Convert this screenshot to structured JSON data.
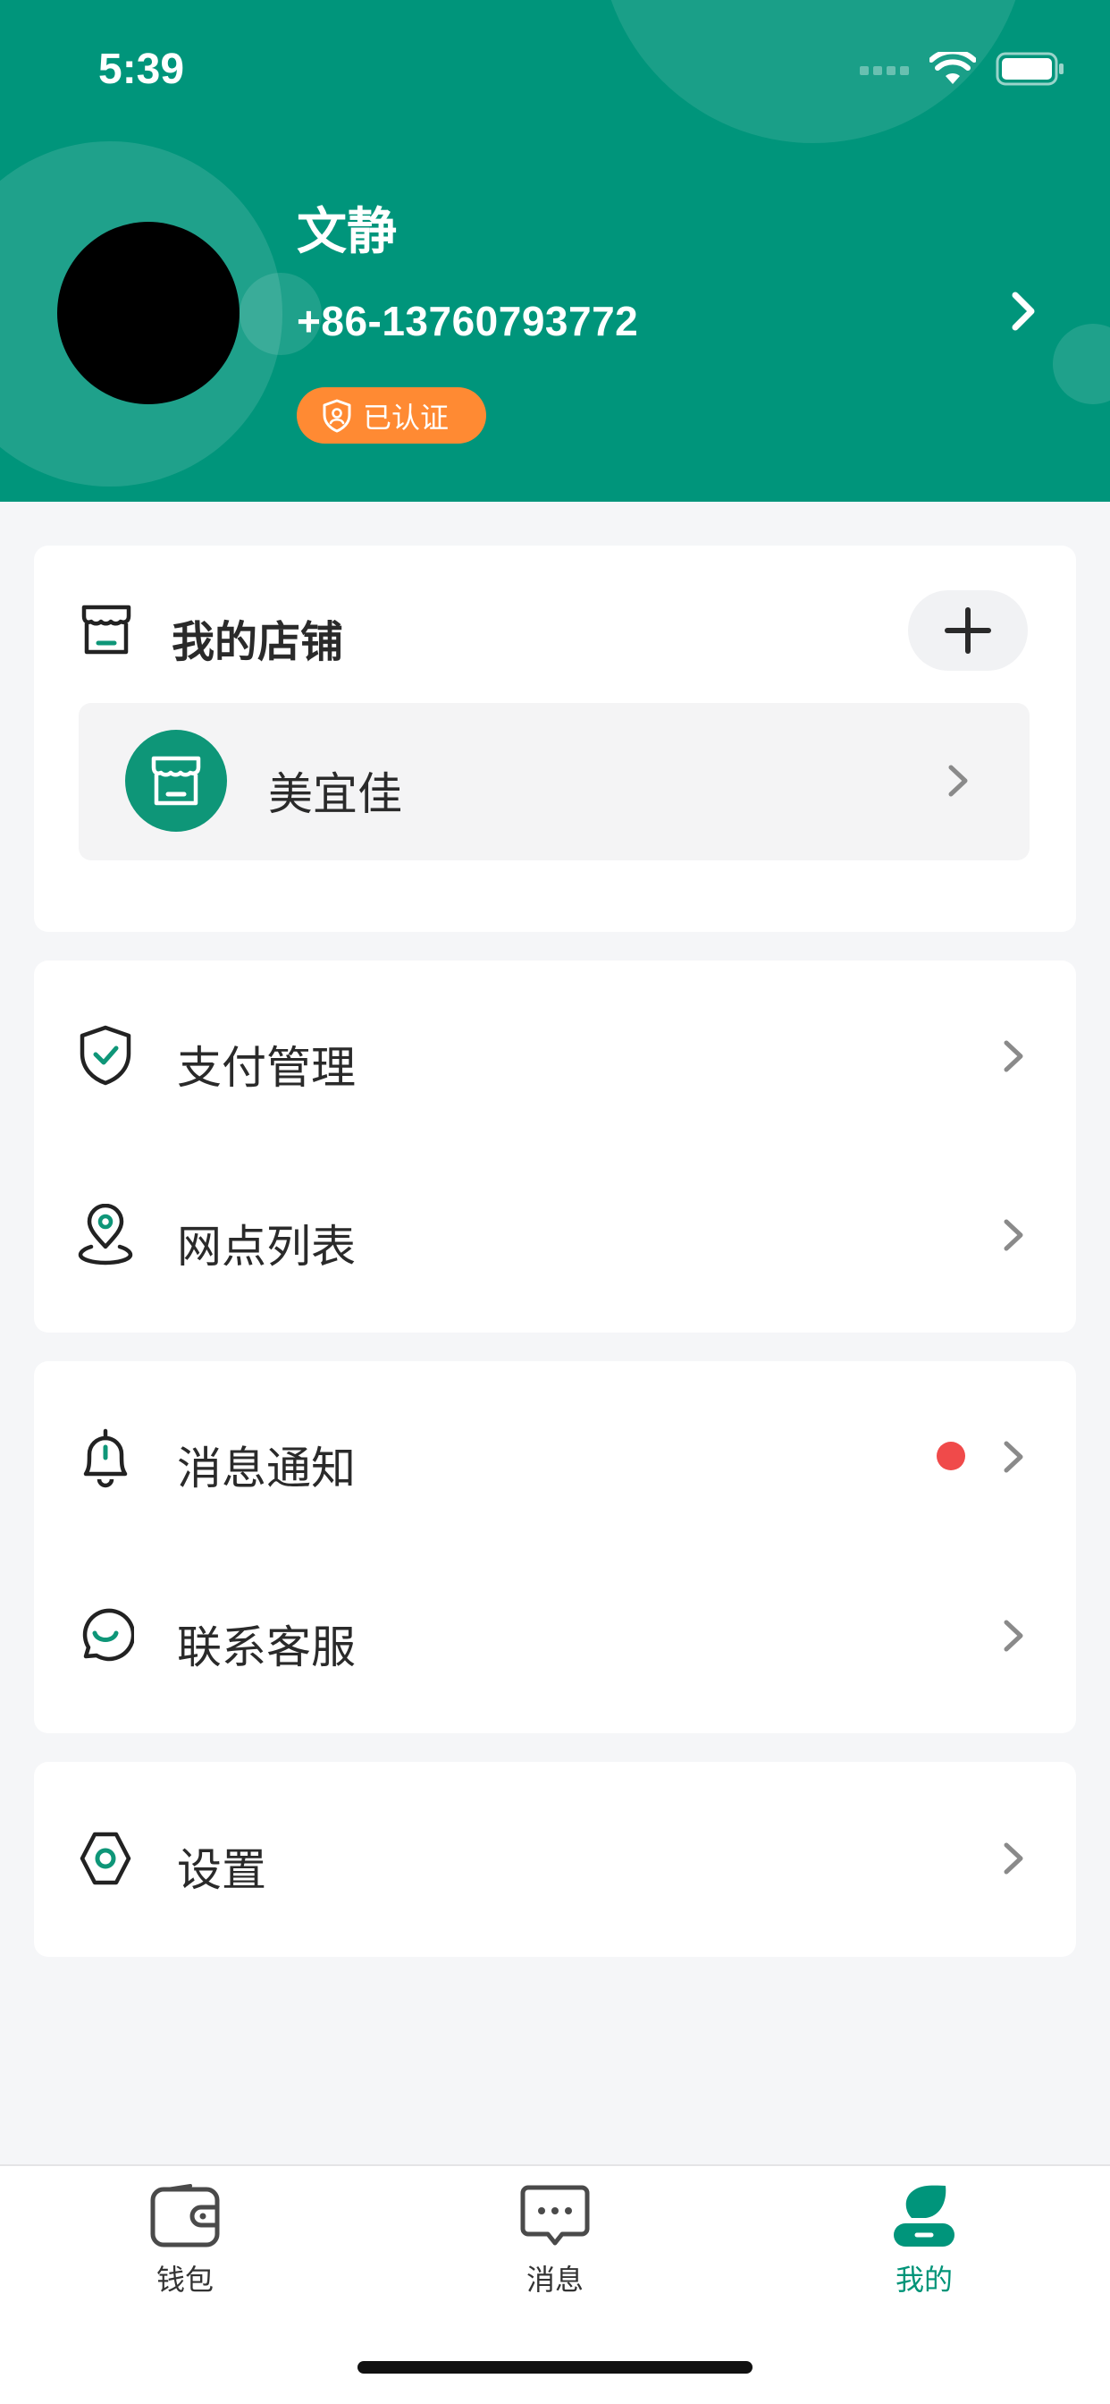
{
  "status_bar": {
    "time": "5:39"
  },
  "profile": {
    "name": "文静",
    "phone": "+86-13760793772",
    "verified_label": "已认证"
  },
  "shop": {
    "title": "我的店铺",
    "store_name": "美宜佳"
  },
  "menu": {
    "payment": "支付管理",
    "outlets": "网点列表",
    "notifications": "消息通知",
    "support": "联系客服",
    "settings": "设置"
  },
  "tabs": [
    {
      "label": "钱包",
      "icon": "wallet-icon"
    },
    {
      "label": "消息",
      "icon": "message-icon"
    },
    {
      "label": "我的",
      "icon": "profile-icon",
      "active": true
    }
  ],
  "colors": {
    "brand": "#00957b",
    "badge": "#ff8a33",
    "alert": "#f04a4a"
  }
}
